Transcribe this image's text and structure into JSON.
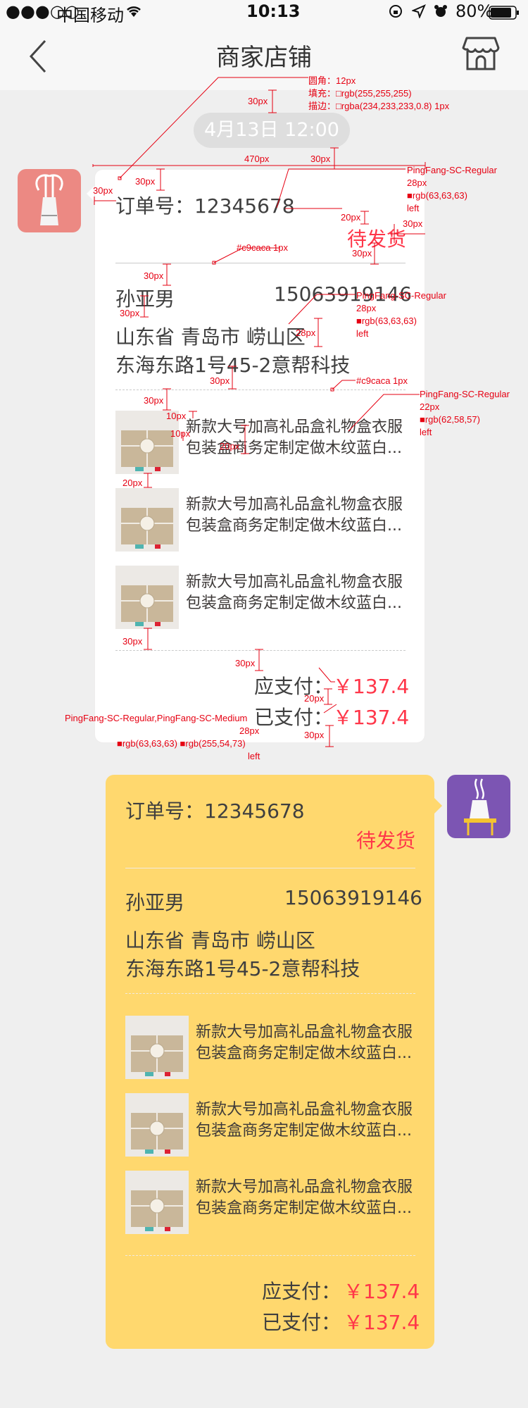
{
  "status_bar": {
    "signal": "●●●○○",
    "carrier": "中国移动",
    "time": "10:13",
    "battery": "80%"
  },
  "nav": {
    "title": "商家店铺"
  },
  "chat": {
    "timestamp": "4月13日 12:00"
  },
  "order_white": {
    "order_label": "订单号：12345678",
    "status": "待发货",
    "name": "孙亚男",
    "phone": "15063919146",
    "address_line1": "山东省 青岛市 崂山区",
    "address_line2": "东海东路1号45-2意帮科技",
    "products": [
      {
        "line1": "新款大号加高礼品盒礼物盒衣服",
        "line2": "包装盒商务定制定做木纹蓝白..."
      },
      {
        "line1": "新款大号加高礼品盒礼物盒衣服",
        "line2": "包装盒商务定制定做木纹蓝白..."
      },
      {
        "line1": "新款大号加高礼品盒礼物盒衣服",
        "line2": "包装盒商务定制定做木纹蓝白..."
      }
    ],
    "due_label": "应支付：",
    "due_amount": "￥137.4",
    "paid_label": "已支付：",
    "paid_amount": "￥137.4"
  },
  "order_yellow": {
    "order_label": "订单号：12345678",
    "status": "待发货",
    "name": "孙亚男",
    "phone": "15063919146",
    "address_line1": "山东省 青岛市 崂山区",
    "address_line2": "东海东路1号45-2意帮科技",
    "products": [
      {
        "line1": "新款大号加高礼品盒礼物盒衣服",
        "line2": "包装盒商务定制定做木纹蓝白..."
      },
      {
        "line1": "新款大号加高礼品盒礼物盒衣服",
        "line2": "包装盒商务定制定做木纹蓝白..."
      },
      {
        "line1": "新款大号加高礼品盒礼物盒衣服",
        "line2": "包装盒商务定制定做木纹蓝白..."
      }
    ],
    "due_label": "应支付：",
    "due_amount": "￥137.4",
    "paid_label": "已支付：",
    "paid_amount": "￥137.4"
  },
  "annotations": {
    "radius": "圆角：12px",
    "fill": "填充：□rgb(255,255,255)",
    "stroke": "描边：□rgba(234,233,233,0.8)   1px",
    "d30a": "30px",
    "d470": "470px",
    "d30b": "30px",
    "d30c": "30px",
    "d30d": "30px",
    "font1": "PingFang-SC-Regular",
    "size1": "28px",
    "color1": "■rgb(63,63,63)",
    "align1": "left",
    "d20a": "20px",
    "d30e": "30px",
    "d30f": "30px",
    "line1": "#c9caca   1px",
    "d30g": "30px",
    "font2": "PingFang-SC-Regular",
    "size2": "28px",
    "d28": "28px",
    "color2": "■rgb(63,63,63)",
    "align2": "left",
    "d30h": "30px",
    "d30i": "30px",
    "line2": "#c9caca   1px",
    "d30j": "30px",
    "font3": "PingFang-SC-Regular",
    "d10a": "10px",
    "size3": "22px",
    "d10b": "10px",
    "color3": "■rgb(62,58,57)",
    "d20b": "20px",
    "align3": "left",
    "d20c": "20px",
    "d30k": "30px",
    "d30l": "30px",
    "d20d": "20px",
    "font4": "PingFang-SC-Regular,PingFang-SC-Medium",
    "size4": "28px",
    "color4": "■rgb(63,63,63)  ■rgb(255,54,73)",
    "align4": "left",
    "d30m": "30px"
  }
}
